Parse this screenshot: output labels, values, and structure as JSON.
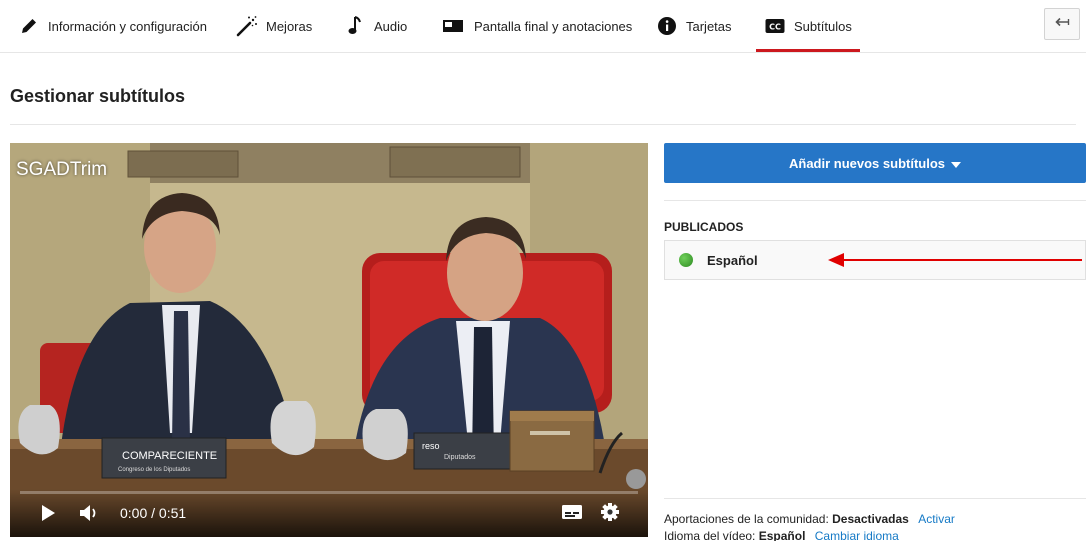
{
  "tabs": [
    {
      "id": "info",
      "label": "Información y configuración",
      "icon": "pencil-icon",
      "active": false
    },
    {
      "id": "mejoras",
      "label": "Mejoras",
      "icon": "magic-wand-icon",
      "active": false
    },
    {
      "id": "audio",
      "label": "Audio",
      "icon": "music-note-icon",
      "active": false
    },
    {
      "id": "pantalla",
      "label": "Pantalla final y anotaciones",
      "icon": "end-screen-icon",
      "active": false
    },
    {
      "id": "tarjetas",
      "label": "Tarjetas",
      "icon": "info-icon",
      "active": false
    },
    {
      "id": "subtitulos",
      "label": "Subtítulos",
      "icon": "cc-icon",
      "active": true
    }
  ],
  "header": {
    "back_icon": "back-arrow-icon",
    "page_title": "Gestionar subtítulos"
  },
  "player": {
    "title": "SGADTrim",
    "time": "0:00 / 0:51",
    "progress": 0.0,
    "cc_label": "CC",
    "icons": [
      "play-icon",
      "volume-icon",
      "subtitles-icon",
      "gear-icon"
    ],
    "overlay_text": {
      "nameplate": "COMPARECIENTE",
      "nameplate_sub": "Congreso de los Diputados",
      "sign_right": "reso",
      "sign_right_sub": "Diputados"
    }
  },
  "panel": {
    "add_button_label": "Añadir nuevos subtítulos",
    "section_label": "PUBLICADOS",
    "published": [
      {
        "language": "Español",
        "status_color": "#3a9b2e"
      }
    ],
    "community_label": "Aportaciones de la comunidad:",
    "community_value": "Desactivadas",
    "community_link": "Activar",
    "video_lang_label": "Idioma del vídeo:",
    "video_lang_value": "Español",
    "video_lang_link": "Cambiar idioma"
  },
  "colors": {
    "accent_red": "#cc181e",
    "button_blue": "#2676c7",
    "link_blue": "#167ac6",
    "arrow_red": "#e00000"
  }
}
